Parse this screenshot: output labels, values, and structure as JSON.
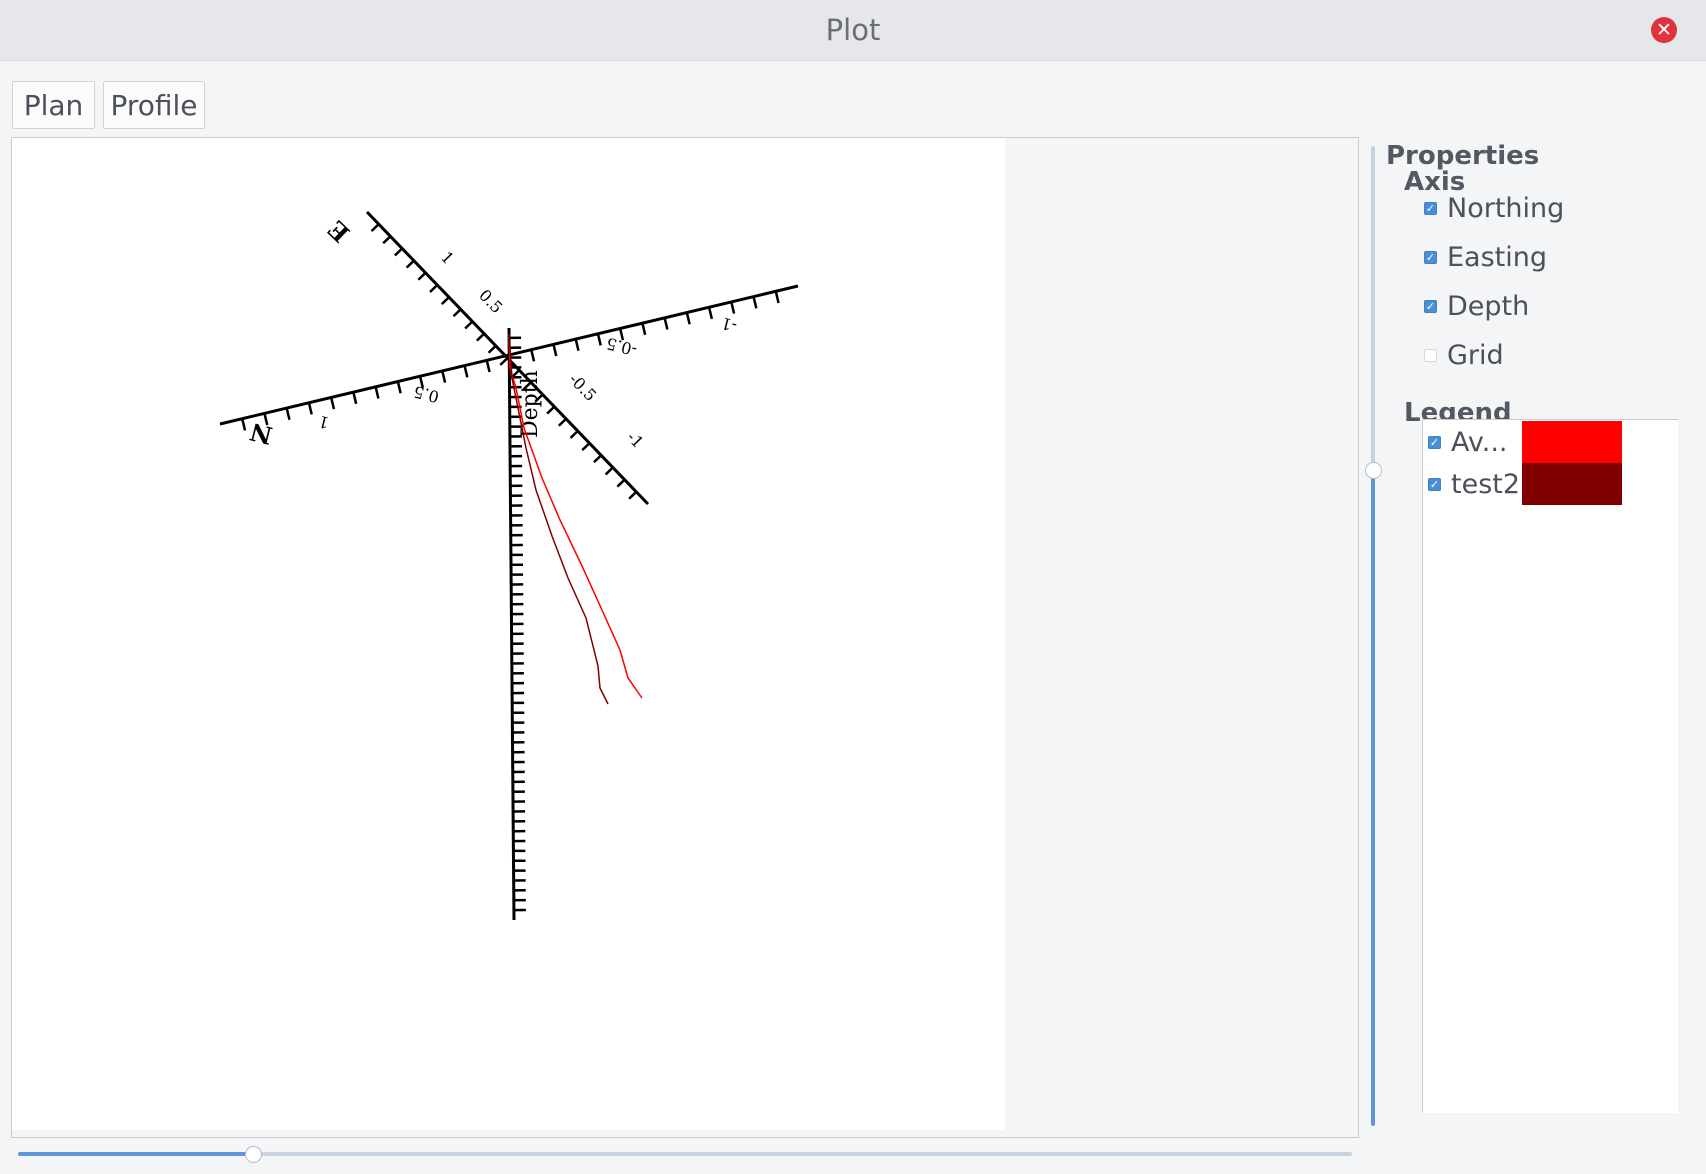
{
  "window": {
    "title": "Plot",
    "close_icon": "close-icon"
  },
  "tabs": [
    {
      "label": "Plan"
    },
    {
      "label": "Profile"
    }
  ],
  "properties": {
    "title": "Properties",
    "axis": {
      "title": "Axis",
      "items": [
        {
          "label": "Northing",
          "checked": true
        },
        {
          "label": "Easting",
          "checked": true
        },
        {
          "label": "Depth",
          "checked": true
        },
        {
          "label": "Grid",
          "checked": false
        }
      ]
    },
    "legend": {
      "title": "Legend",
      "items": [
        {
          "label": "Av...",
          "checked": true,
          "color": "#ff0000"
        },
        {
          "label": "test2",
          "checked": true,
          "color": "#800000"
        }
      ]
    }
  },
  "plot": {
    "axis_labels": {
      "northing": "N",
      "easting": "E",
      "depth": "Depth"
    },
    "northing_ticks": [
      "1",
      "0.5",
      "-0.5",
      "-1"
    ],
    "easting_ticks": [
      "1",
      "0.5",
      "-0.5",
      "-1"
    ],
    "series_colors": [
      "#ff0000",
      "#800000"
    ]
  },
  "sliders": {
    "horizontal_value": 0.18,
    "vertical_value": 0.67
  }
}
